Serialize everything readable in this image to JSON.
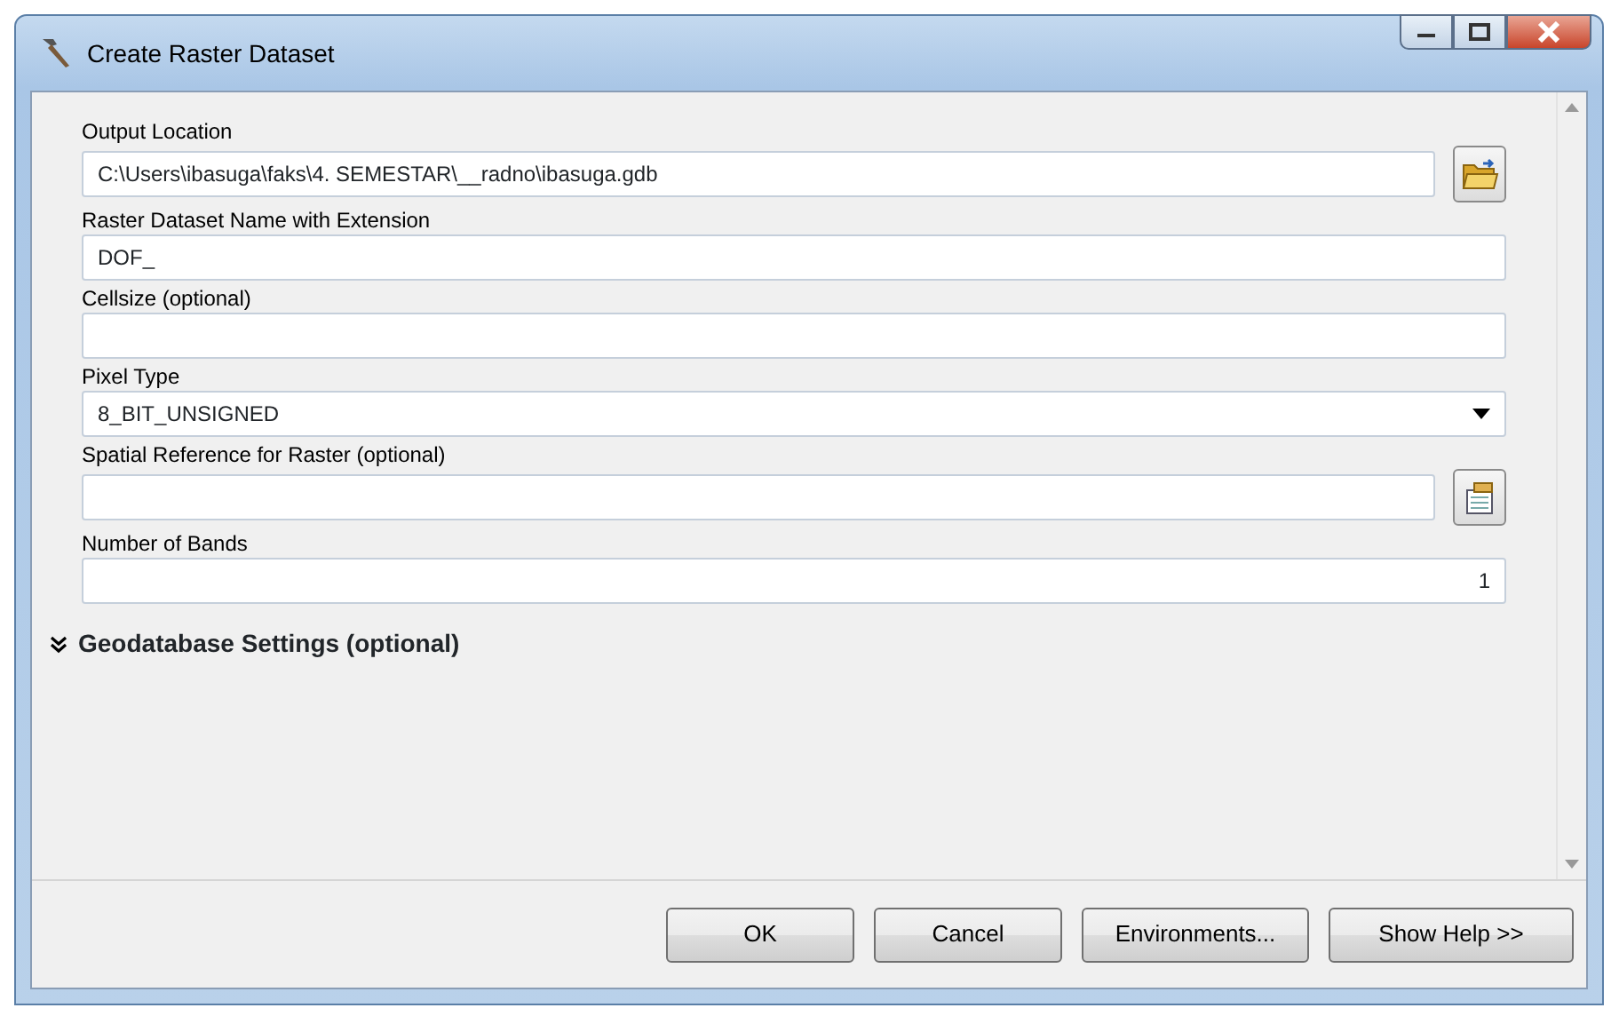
{
  "window": {
    "title": "Create Raster Dataset"
  },
  "fields": [
    {
      "label": "Output Location",
      "kind": "path",
      "value": "C:\\Users\\ibasuga\\faks\\4. SEMESTAR\\__radno\\ibasuga.gdb"
    },
    {
      "label": "Raster Dataset Name with Extension",
      "kind": "text",
      "value": "DOF_"
    },
    {
      "label": "Cellsize (optional)",
      "kind": "text"
    },
    {
      "label": "Pixel Type",
      "kind": "dropdown",
      "value": "8_BIT_UNSIGNED"
    },
    {
      "label": "Spatial Reference for Raster (optional)",
      "kind": "reference"
    },
    {
      "label": "Number of Bands",
      "kind": "number",
      "value": "1"
    }
  ],
  "section": {
    "title": "Geodatabase Settings (optional)",
    "expanded": false
  },
  "buttons": [
    "OK",
    "Cancel",
    "Environments...",
    "Show Help >>"
  ]
}
